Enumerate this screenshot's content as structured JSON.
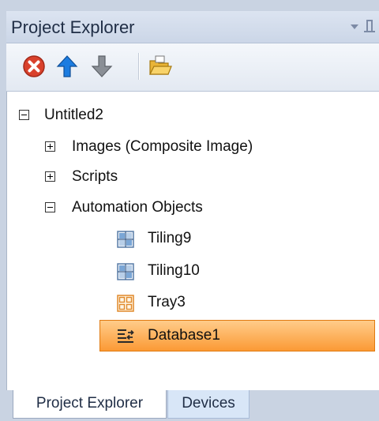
{
  "panel": {
    "title": "Project Explorer",
    "toolbar": {
      "remove": "remove-icon",
      "move_up": "arrow-up-icon",
      "move_down": "arrow-down-icon",
      "open": "open-folder-icon"
    }
  },
  "tree": {
    "root": {
      "label": "Untitled2",
      "expanded": true
    },
    "children": [
      {
        "label": "Images (Composite Image)",
        "expanded": false
      },
      {
        "label": "Scripts",
        "expanded": false
      },
      {
        "label": "Automation Objects",
        "expanded": true,
        "items": [
          {
            "label": "Tiling9",
            "icon": "tiling-icon"
          },
          {
            "label": "Tiling10",
            "icon": "tiling-icon"
          },
          {
            "label": "Tray3",
            "icon": "tray-icon"
          },
          {
            "label": "Database1",
            "icon": "database-icon",
            "selected": true
          }
        ]
      }
    ]
  },
  "tabs": [
    {
      "label": "Project Explorer",
      "active": true
    },
    {
      "label": "Devices",
      "active": false
    }
  ],
  "colors": {
    "selection": "#fb9a35",
    "panel_bg": "#c9d3e2",
    "accent_blue": "#1c7ce0"
  }
}
